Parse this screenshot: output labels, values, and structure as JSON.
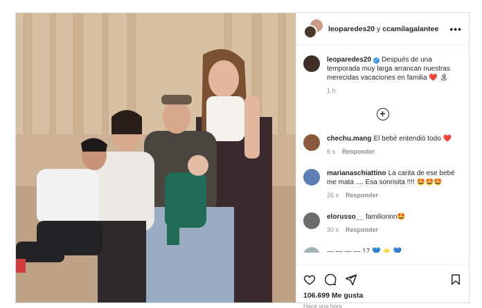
{
  "header": {
    "user1": "leoparedes20",
    "joiner": "y",
    "user2": "ccamilagalantee",
    "more_icon": "more-horizontal-icon"
  },
  "caption": {
    "username": "leoparedes20",
    "verified_icon": "verified-badge-icon",
    "text": "Después de una temporada muy larga arrancan nuestras merecidas vacaciones en familia",
    "emoji": "❤️ 🏝",
    "time": "1 h"
  },
  "load_more_icon": "plus-circle-icon",
  "comments": [
    {
      "username": "chechu.mang",
      "text": "El bebé entendió todo ❤️",
      "time": "6 s",
      "reply": "Responder",
      "avatar_color": "#8a5a3c"
    },
    {
      "username": "marianaschiattino",
      "text": "La carita de ese bebé me mata .... Esa sonrisita !!!! 🤩🤩🤩",
      "time": "26 s",
      "reply": "Responder",
      "avatar_color": "#5b7fb0"
    },
    {
      "username": "elorusso__",
      "text": "familionnn🤩",
      "time": "30 s",
      "reply": "Responder",
      "avatar_color": "#6b6b6b"
    }
  ],
  "partial_comment": "— — — — 17 💙 ⭐ 💙",
  "actions": {
    "like_icon": "heart-icon",
    "comment_icon": "comment-icon",
    "share_icon": "send-icon",
    "save_icon": "bookmark-icon"
  },
  "likes": "106.699 Me gusta",
  "posted": "Hace una hora",
  "colors": {
    "accent_heart": "#ed4956",
    "verified": "#3897f0",
    "muted": "#8e8e8e"
  }
}
